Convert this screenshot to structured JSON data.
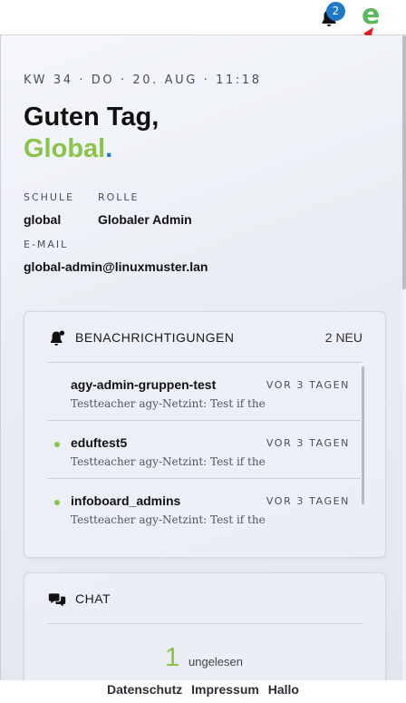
{
  "topbar": {
    "notification_count": "2",
    "logo_letter": "e"
  },
  "header": {
    "datetime": "KW 34 · DO · 20. AUG · 11:18",
    "greeting": "Guten Tag,",
    "user_name": "Global",
    "user_name_punct": "."
  },
  "profile": {
    "school_label": "SCHULE",
    "school_value": "global",
    "role_label": "ROLLE",
    "role_value": "Globaler Admin",
    "email_label": "E-MAIL",
    "email_value": "global-admin@linuxmuster.lan"
  },
  "notifications": {
    "title": "BENACHRICHTIGUNGEN",
    "count": "2 NEU",
    "items": [
      {
        "subject": "agy-admin-gruppen-test",
        "when": "VOR 3 TAGEN",
        "preview": "Testteacher agy-Netzint: Test if the message is visible",
        "unread": false
      },
      {
        "subject": "eduftest5",
        "when": "VOR 3 TAGEN",
        "preview": "Testteacher agy-Netzint: Test if the message is visible",
        "unread": true
      },
      {
        "subject": "infoboard_admins",
        "when": "VOR 3 TAGEN",
        "preview": "Testteacher agy-Netzint: Test if the message is visible",
        "unread": true
      }
    ]
  },
  "chat": {
    "title": "CHAT",
    "unread_count": "1",
    "unread_label": "ungelesen"
  },
  "footer": {
    "links": [
      "Datenschutz",
      "Impressum",
      "Hallo"
    ]
  },
  "colors": {
    "accent_green": "#8bc34a",
    "accent_blue": "#1f7ac6",
    "annotation_red": "#e02020"
  }
}
